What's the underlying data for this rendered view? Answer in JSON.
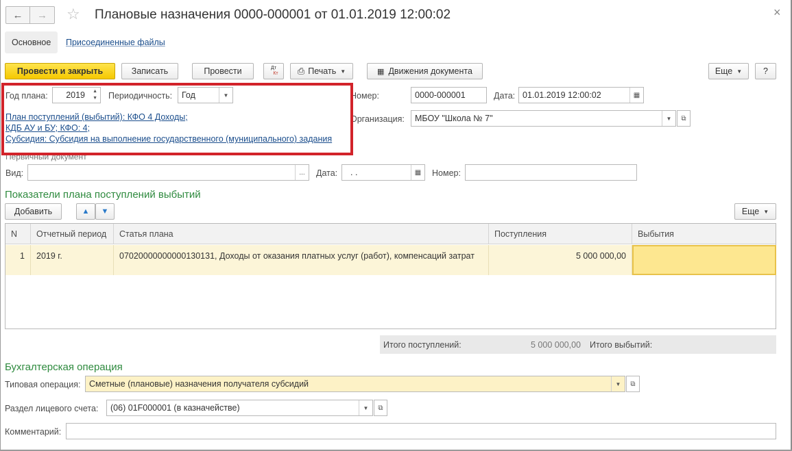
{
  "window": {
    "title": "Плановые назначения 0000-000001 от 01.01.2019 12:00:02",
    "back_icon": "←",
    "forward_icon": "→",
    "star_icon": "☆",
    "close_icon": "×"
  },
  "tabs": {
    "main": "Основное",
    "files": "Присоединенные файлы"
  },
  "toolbar": {
    "post_close": "Провести и закрыть",
    "save": "Записать",
    "post": "Провести",
    "dt_kt_top": "Дт",
    "dt_kt_bottom": "Кт",
    "print": "Печать",
    "movements": "Движения документа",
    "more": "Еще",
    "help": "?"
  },
  "header": {
    "year_label": "Год плана:",
    "year_value": "2019",
    "period_label": "Периодичность:",
    "period_value": "Год",
    "number_label": "Номер:",
    "number_value": "0000-000001",
    "date_label": "Дата:",
    "date_value": "01.01.2019 12:00:02",
    "org_label": "Организация:",
    "org_value": "МБОУ \"Школа № 7\"",
    "link1": "План поступлений (выбытий): КФО 4 Доходы;",
    "link2": "КДБ АУ и БУ; КФО: 4;",
    "link3": "Субсидия: Субсидия на выполнение государственного (муниципального) задания"
  },
  "primary_doc": {
    "caption": "Первичный документ",
    "type_label": "Вид:",
    "type_value": "",
    "date_label": "Дата:",
    "date_value": " .  .",
    "number_label": "Номер:",
    "number_value": ""
  },
  "indicators": {
    "title": "Показатели плана поступлений выбытий",
    "add": "Добавить",
    "more": "Еще",
    "columns": [
      "N",
      "Отчетный период",
      "Статья плана",
      "Поступления",
      "Выбытия"
    ],
    "rows": [
      {
        "n": "1",
        "period": "2019 г.",
        "article": "07020000000000130131, Доходы от оказания платных услуг (работ), компенсаций затрат",
        "income": "5 000 000,00",
        "expense": ""
      }
    ],
    "total_income_label": "Итого поступлений:",
    "total_income_value": "5 000 000,00",
    "total_expense_label": "Итого выбытий:"
  },
  "accounting": {
    "title": "Бухгалтерская операция",
    "op_label": "Типовая операция:",
    "op_value": "Сметные (плановые) назначения получателя субсидий",
    "section_label": "Раздел лицевого счета:",
    "section_value": "(06) 01F000001 (в казначействе)",
    "comment_label": "Комментарий:",
    "comment_value": ""
  },
  "icons": {
    "dropdown": "▼",
    "open": "⧉",
    "calendar": "▦",
    "printer": "⎙",
    "up": "▲",
    "down": "▼",
    "ellipsis": "..."
  }
}
